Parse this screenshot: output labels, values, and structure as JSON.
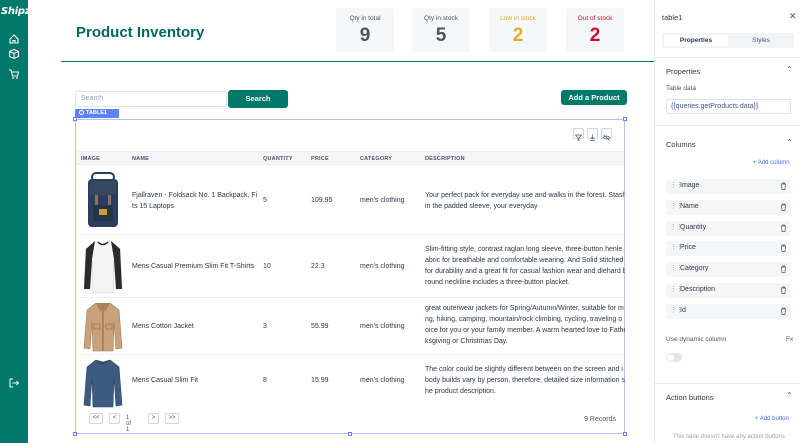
{
  "app": {
    "logo": "Shipzy"
  },
  "rail": {
    "icons": [
      "home-icon",
      "box-icon",
      "cart-icon",
      "logout-icon"
    ]
  },
  "page": {
    "title": "Product Inventory"
  },
  "stats": [
    {
      "label": "Qty in total",
      "value": "9",
      "color": "#4a5568"
    },
    {
      "label": "Qty in stock",
      "value": "5",
      "color": "#4a5568"
    },
    {
      "label": "Low in stock",
      "value": "2",
      "color": "#e7a92b"
    },
    {
      "label": "Out of stock",
      "value": "2",
      "color": "#c8102e"
    }
  ],
  "search": {
    "placeholder": "Search",
    "button": "Search"
  },
  "add_button": "Add a Product",
  "table": {
    "tag": "TABLE1",
    "columns": [
      "IMAGE",
      "NAME",
      "QUANTITY",
      "PRICE",
      "CATEGORY",
      "DESCRIPTION"
    ],
    "rows": [
      {
        "name": "Fjallraven - Foldsack No. 1 Backpack, Fits 15 Laptops",
        "name_lines": [
          "Fjallraven - Foldsack No. 1 Backpack, Fi",
          "ts 15 Laptops"
        ],
        "quantity": "5",
        "price": "109.95",
        "category": "men's clothing",
        "desc_lines": [
          "Your perfect pack for everyday use and walks in the forest. Stash",
          "in the padded sleeve, your everyday"
        ]
      },
      {
        "name": "Mens Casual Premium Slim Fit T-Shirts",
        "name_lines": [
          "Mens Casual Premium Slim Fit T-Shirts"
        ],
        "quantity": "10",
        "price": "22.3",
        "category": "men's clothing",
        "desc_lines": [
          "Slim-fitting style, contrast raglan long sleeve, three-button henle",
          "abric for breathable and comfortable wearing. And Solid stitched",
          "for durability and a great fit for casual fashion wear and diehard b",
          "round neckline includes a three-button placket."
        ]
      },
      {
        "name": "Mens Cotton Jacket",
        "name_lines": [
          "Mens Cotton Jacket"
        ],
        "quantity": "3",
        "price": "55.99",
        "category": "men's clothing",
        "desc_lines": [
          "great outerwear jackets for Spring/Autumn/Winter, suitable for m",
          "ng, hiking, camping, mountain/rock climbing, cycling, traveling o",
          "oice for you or your family member. A warm hearted love to Fathe",
          "ksgiving or Christmas Day."
        ]
      },
      {
        "name": "Mens Casual Slim Fit",
        "name_lines": [
          "Mens Casual Slim Fit"
        ],
        "quantity": "8",
        "price": "15.99",
        "category": "men's clothing",
        "desc_lines": [
          "The color could be slightly different between on the screen and i",
          "body builds vary by person, therefore, detailed size information s",
          "he product description."
        ]
      }
    ],
    "pager": {
      "first": "<<",
      "prev": "<",
      "page_text": "1 of 1",
      "next": ">",
      "last": ">>"
    },
    "records": "9 Records"
  },
  "panel": {
    "widget_name": "table1",
    "tabs": [
      "Properties",
      "Styles"
    ],
    "properties_section": "Properties",
    "table_data_label": "Table data",
    "table_data_value": "{{queries.getProducts.data}}",
    "columns_section": "Columns",
    "add_column": "+ Add column",
    "columns": [
      "Image",
      "Name",
      "Quantity",
      "Price",
      "Category",
      "Description",
      "Id"
    ],
    "dynamic_column_label": "Use dynamic column",
    "fx_label": "Fx",
    "action_section": "Action buttons",
    "add_button": "+ Add button",
    "action_note": "This table doesn't have any action buttons"
  },
  "colors": {
    "brand": "#00796b",
    "selection": "#5f82f5"
  }
}
